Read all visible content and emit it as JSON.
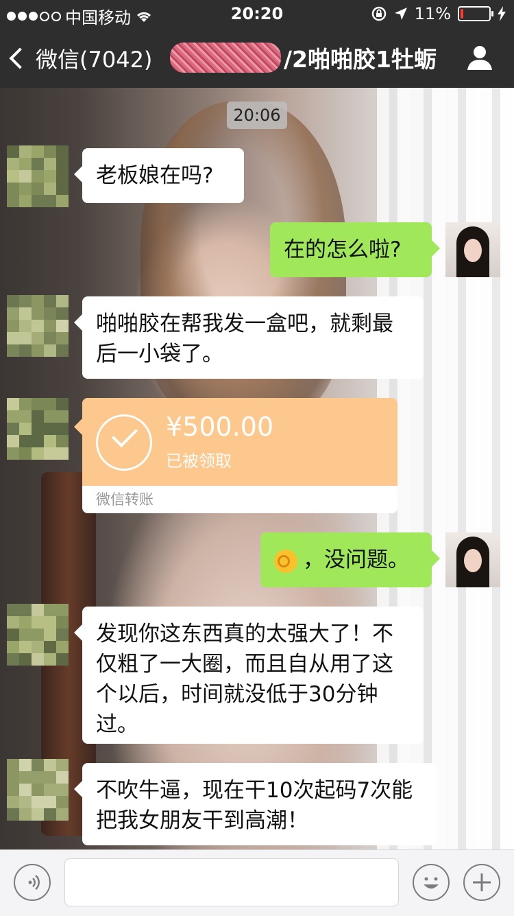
{
  "status_bar": {
    "carrier": "中国移动",
    "time": "20:20",
    "battery": "11%",
    "battery_level": 0.11
  },
  "nav": {
    "back_label": "微信(7042)",
    "title": "/2啪啪胶1牡蛎"
  },
  "chat": {
    "timestamp": "20:06",
    "messages": [
      {
        "side": "left",
        "text": "老板娘在吗?"
      },
      {
        "side": "right",
        "text": "在的怎么啦?"
      },
      {
        "side": "left",
        "text": "啪啪胶在帮我发一盒吧，就剩最后一小袋了。"
      },
      {
        "side": "left",
        "type": "transfer",
        "amount": "¥500.00",
        "status": "已被领取",
        "footer": "微信转账"
      },
      {
        "side": "right",
        "emoji": "ok-hand",
        "text": "，没问题。"
      },
      {
        "side": "left",
        "text": "发现你这东西真的太强大了！不仅粗了一大圈，而且自从用了这个以后，时间就没低于30分钟过。"
      },
      {
        "side": "left",
        "text": "不吹牛逼，现在干10次起码7次能把我女朋友干到高潮！"
      }
    ]
  },
  "colors": {
    "nav_bg": "#2e2e2e",
    "green_bubble": "#a0e75a",
    "transfer_orange": "#fcc88d",
    "battery_red": "#ff3b30"
  },
  "icons": [
    "wifi-icon",
    "lock-rotation-icon",
    "location-arrow-icon",
    "battery-icon",
    "charging-icon",
    "back-chevron-icon",
    "person-icon",
    "check-icon",
    "voice-icon",
    "emoji-icon",
    "plus-icon"
  ]
}
